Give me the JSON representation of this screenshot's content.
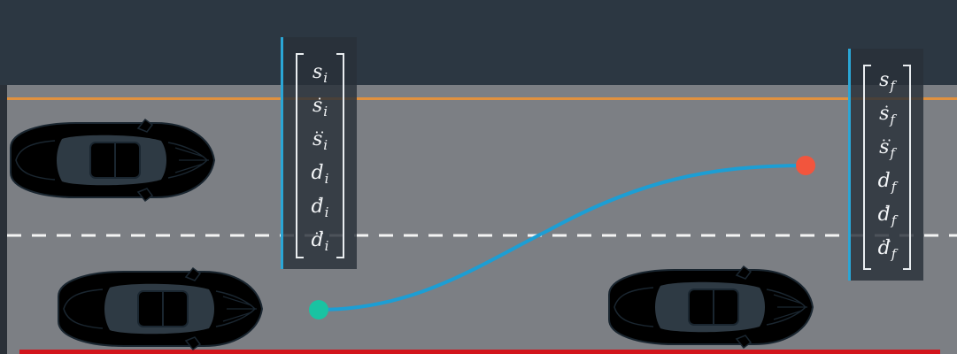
{
  "colors": {
    "sky": "#2c3742",
    "road": "#7c7f84",
    "road_edge_line": "#e0913f",
    "lane_divider": "#f4f4f4",
    "bottom_bar": "#d2151c",
    "trajectory": "#1c9ed4",
    "start_point": "#19c3a2",
    "goal_point": "#f2553d",
    "ego_car": "#20b8e3",
    "other_car": "#26cdb0",
    "car_glass": "#2e3a44"
  },
  "icons": {
    "ego_vehicle": "car-top-view-icon",
    "other_vehicle": "car-top-view-icon"
  },
  "initial_state": {
    "s": "s",
    "s_dot": "s",
    "s_ddot": "s",
    "d": "d",
    "d_dot": "d",
    "d_ddot": "d",
    "subscript": "i"
  },
  "final_state": {
    "s": "s",
    "s_dot": "s",
    "s_ddot": "s",
    "d": "d",
    "d_dot": "d",
    "d_ddot": "d",
    "subscript": "f"
  }
}
